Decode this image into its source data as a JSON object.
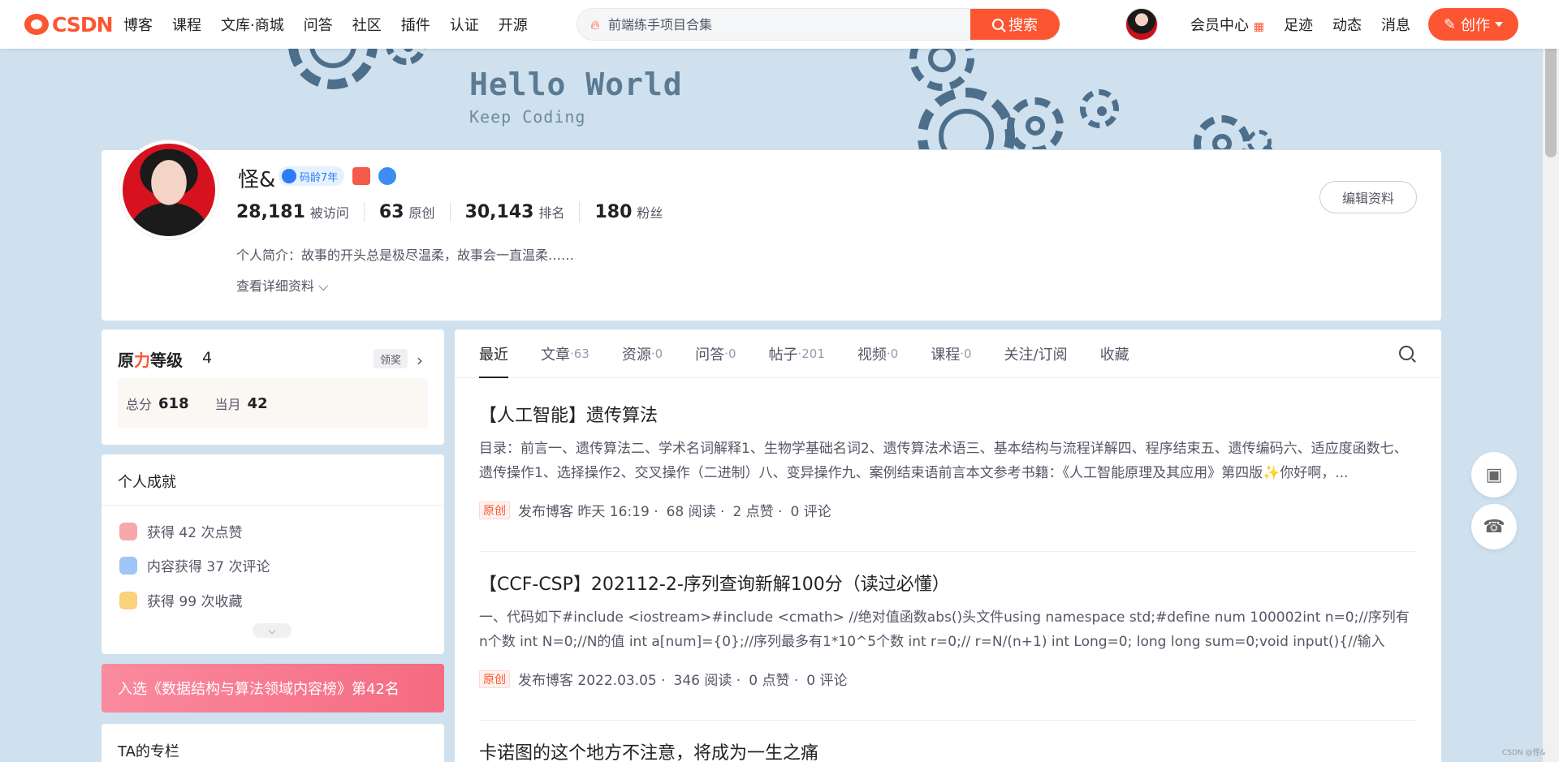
{
  "logo_text": "CSDN",
  "nav": [
    "博客",
    "课程",
    "文库·商城",
    "问答",
    "社区",
    "插件",
    "认证",
    "开源"
  ],
  "search": {
    "placeholder": "前端练手项目合集",
    "button": "搜索"
  },
  "top_links": [
    "会员中心",
    "足迹",
    "动态",
    "消息"
  ],
  "create_label": "创作",
  "banner": {
    "title": "Hello World",
    "subtitle": "Keep Coding"
  },
  "profile": {
    "name": "怪&",
    "code_age_badge": "码龄7年",
    "stats": [
      {
        "num": "28,181",
        "label": "被访问"
      },
      {
        "num": "63",
        "label": "原创"
      },
      {
        "num": "30,143",
        "label": "排名"
      },
      {
        "num": "180",
        "label": "粉丝"
      }
    ],
    "bio": "个人简介：故事的开头总是极尽温柔，故事会一直温柔……",
    "more": "查看详细资料",
    "edit": "编辑资料"
  },
  "level": {
    "title_a": "原",
    "title_b": "力",
    "title_c": "等级",
    "value": "4",
    "tag": "领奖",
    "total_label": "总分",
    "total": "618",
    "month_label": "当月",
    "month": "42"
  },
  "achievements": {
    "title": "个人成就",
    "items": [
      "获得 42 次点赞",
      "内容获得 37 次评论",
      "获得 99 次收藏"
    ]
  },
  "rank_banner": "入选《数据结构与算法领域内容榜》第42名",
  "column_title": "TA的专栏",
  "tabs": [
    {
      "label": "最近",
      "count": ""
    },
    {
      "label": "文章",
      "count": "·63"
    },
    {
      "label": "资源",
      "count": "·0"
    },
    {
      "label": "问答",
      "count": "·0"
    },
    {
      "label": "帖子",
      "count": "·201"
    },
    {
      "label": "视频",
      "count": "·0"
    },
    {
      "label": "课程",
      "count": "·0"
    },
    {
      "label": "关注/订阅",
      "count": ""
    },
    {
      "label": "收藏",
      "count": ""
    }
  ],
  "posts": [
    {
      "title": "【人工智能】遗传算法",
      "desc": "目录：前言一、遗传算法二、学术名词解释1、生物学基础名词2、遗传算法术语三、基本结构与流程详解四、程序结束五、遗传编码六、适应度函数七、遗传操作1、选择操作2、交叉操作（二进制）八、变异操作九、案例结束语前言本文参考书籍：《人工智能原理及其应用》第四版✨你好啊，...",
      "tag": "原创",
      "published": "发布博客 昨天 16:19 ·",
      "reads": "68 阅读 ·",
      "likes": "2 点赞 ·",
      "comments": "0 评论"
    },
    {
      "title": "【CCF-CSP】202112-2-序列查询新解100分（读过必懂）",
      "desc": "一、代码如下#include <iostream>#include <cmath> //绝对值函数abs()头文件using namespace std;#define num 100002int n=0;//序列有n个数 int N=0;//N的值 int a[num]={0};//序列最多有1*10^5个数 int r=0;// r=N/(n+1) int Long=0; long long sum=0;void input(){//输入 cin>>n>>N; for(",
      "tag": "原创",
      "published": "发布博客 2022.03.05 ·",
      "reads": "346 阅读 ·",
      "likes": "0 点赞 ·",
      "comments": "0 评论"
    },
    {
      "title": "卡诺图的这个地方不注意，将成为一生之痛"
    }
  ],
  "watermark": "CSDN @怪&",
  "colors": {
    "accent": "#fc5531",
    "background": "#cfe1ee",
    "text": "#222226"
  }
}
